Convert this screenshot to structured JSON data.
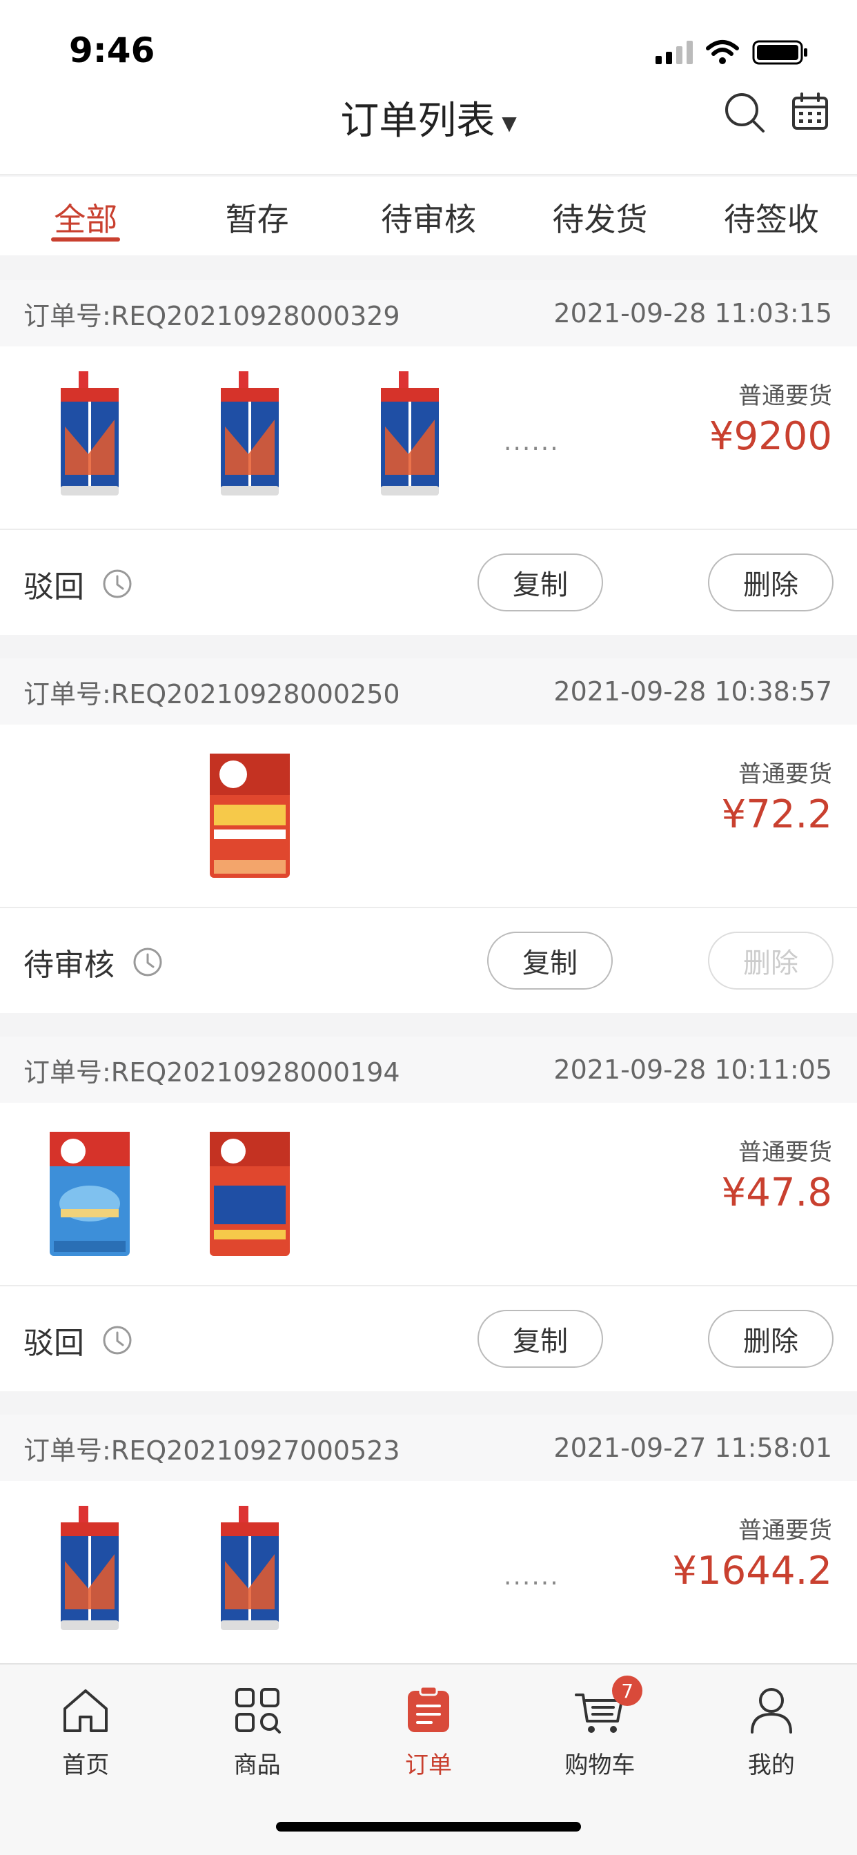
{
  "status_bar": {
    "time": "9:46"
  },
  "header": {
    "title": "订单列表",
    "title_caret": "▼"
  },
  "tabs": [
    {
      "label": "全部",
      "active": true
    },
    {
      "label": "暂存"
    },
    {
      "label": "待审核"
    },
    {
      "label": "待发货"
    },
    {
      "label": "待签收"
    }
  ],
  "orders": [
    {
      "order_no": "订单号:REQ20210928000329",
      "datetime": "2021-09-28  11:03:15",
      "type": "普通要货",
      "price": "¥9200",
      "more": "......",
      "status": "驳回",
      "copy_label": "复制",
      "delete_label": "删除",
      "delete_enabled": true,
      "products": [
        "sealant-tube",
        "sealant-tube",
        "sealant-tube"
      ]
    },
    {
      "order_no": "订单号:REQ20210928000250",
      "datetime": "2021-09-28  10:38:57",
      "type": "普通要货",
      "price": "¥72.2",
      "status": "待审核",
      "copy_label": "复制",
      "delete_label": "删除",
      "delete_enabled": false,
      "products": [
        "tile-adhesive-bag-red"
      ]
    },
    {
      "order_no": "订单号:REQ20210928000194",
      "datetime": "2021-09-28  10:11:05",
      "type": "普通要货",
      "price": "¥47.8",
      "status": "驳回",
      "copy_label": "复制",
      "delete_label": "删除",
      "delete_enabled": true,
      "products": [
        "tile-adhesive-bag-blue",
        "tile-adhesive-bag-red"
      ]
    },
    {
      "order_no": "订单号:REQ20210927000523",
      "datetime": "2021-09-27  11:58:01",
      "type": "普通要货",
      "price": "¥1644.2",
      "more": "......",
      "products": [
        "sealant-tube",
        "sealant-tube"
      ]
    }
  ],
  "tabbar": [
    {
      "label": "首页",
      "icon": "home-icon"
    },
    {
      "label": "商品",
      "icon": "grid-icon"
    },
    {
      "label": "订单",
      "icon": "order-icon",
      "active": true
    },
    {
      "label": "购物车",
      "icon": "cart-icon",
      "badge": "7"
    },
    {
      "label": "我的",
      "icon": "user-icon"
    }
  ],
  "colors": {
    "accent": "#c9402f",
    "background": "#f4f4f5"
  }
}
